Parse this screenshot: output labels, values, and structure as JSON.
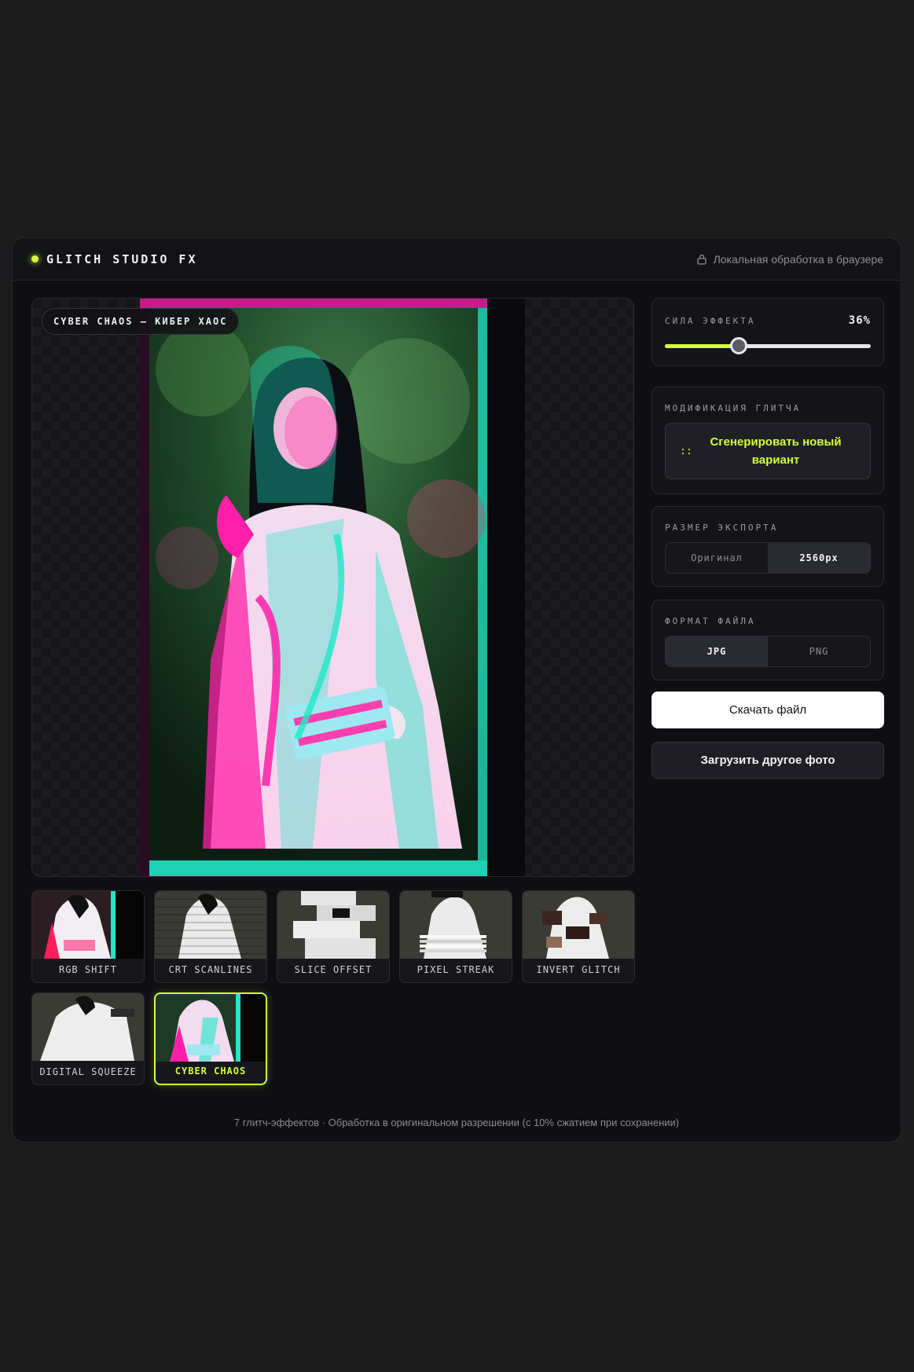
{
  "header": {
    "brand": "GLITCH STUDIO FX",
    "privacy_note": "Локальная обработка в браузере"
  },
  "preview": {
    "badge": "CYBER CHAOS — КИБЕР ХАОС"
  },
  "effects": [
    {
      "label": "RGB SHIFT"
    },
    {
      "label": "CRT SCANLINES"
    },
    {
      "label": "SLICE OFFSET"
    },
    {
      "label": "PIXEL STREAK"
    },
    {
      "label": "INVERT GLITCH"
    },
    {
      "label": "DIGITAL SQUEEZE"
    },
    {
      "label": "CYBER CHAOS",
      "selected": true
    }
  ],
  "strength": {
    "title": "СИЛА ЭФФЕКТА",
    "value_label": "36%",
    "value": 36
  },
  "modification": {
    "title": "МОДИФИКАЦИЯ ГЛИТЧА",
    "button_icon": "::",
    "button_label": "Сгенерировать новый вариант"
  },
  "export_size": {
    "title": "РАЗМЕР ЭКСПОРТА",
    "options": [
      "Оригинал",
      "2560px"
    ],
    "selected": "2560px"
  },
  "file_format": {
    "title": "ФОРМАТ ФАЙЛА",
    "options": [
      "JPG",
      "PNG"
    ],
    "selected": "JPG"
  },
  "actions": {
    "download": "Скачать файл",
    "upload_other": "Загрузить другое фото"
  },
  "footer": "7 глитч-эффектов · Обработка в оригинальном разрешении (с 10% сжатием при сохранении)",
  "colors": {
    "accent": "#d4ff3a",
    "magenta": "#ff1fa8",
    "cyan": "#1de8c8"
  }
}
